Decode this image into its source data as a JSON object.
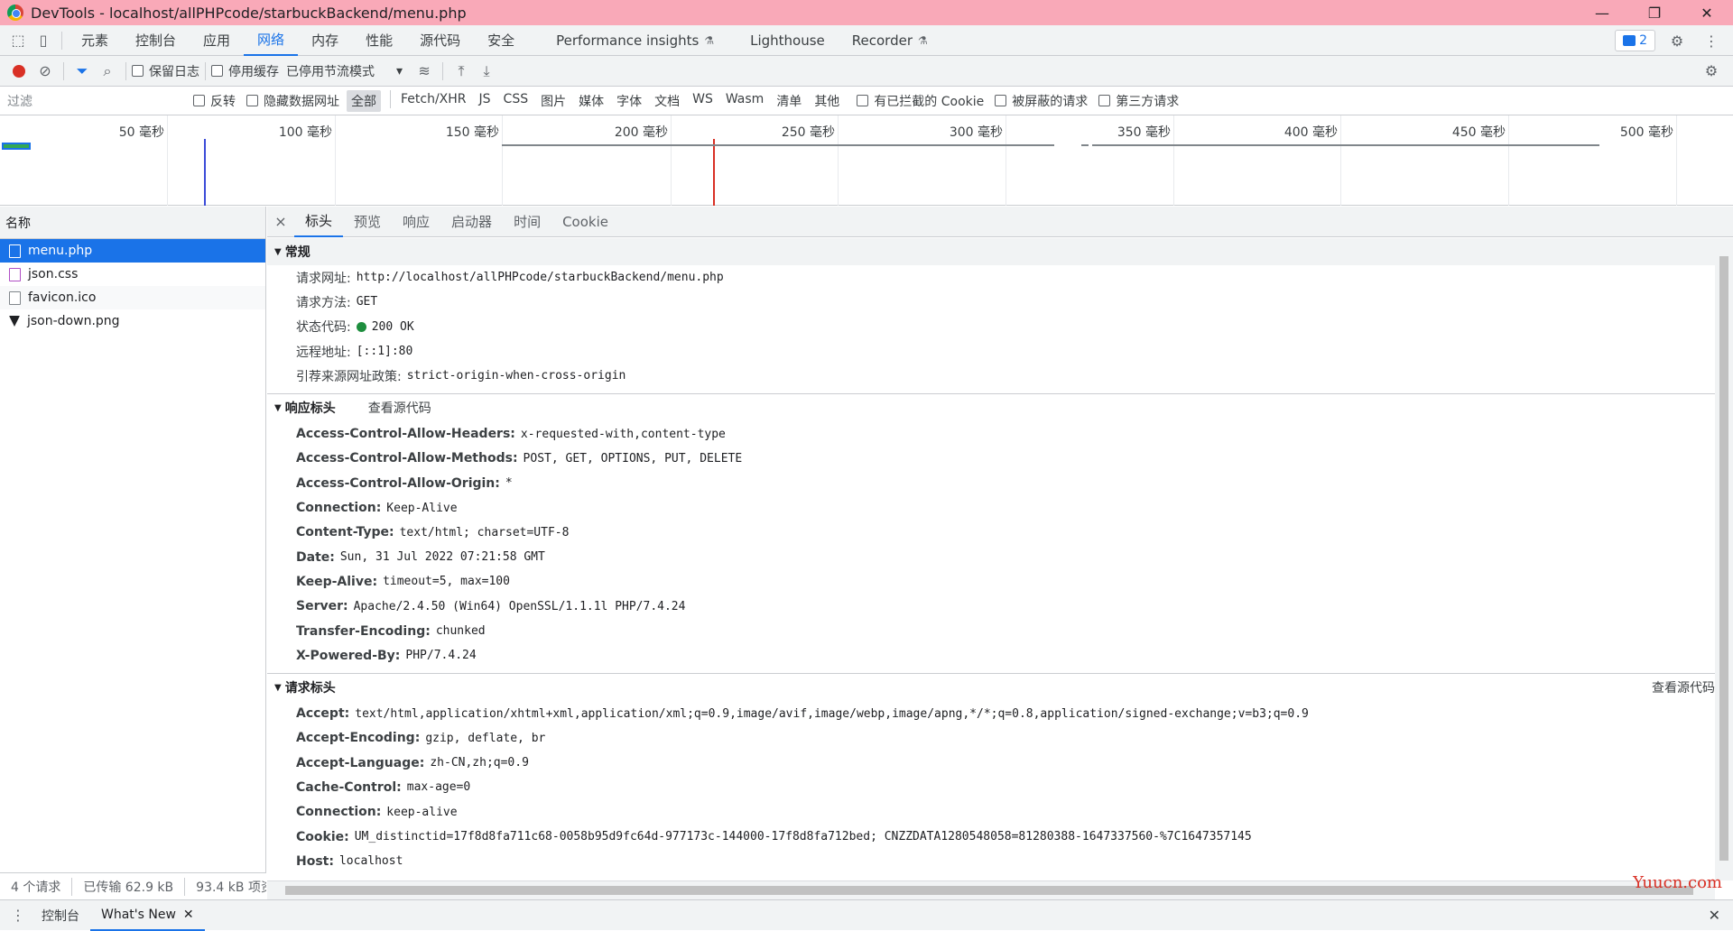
{
  "window": {
    "title": "DevTools - localhost/allPHPcode/starbuckBackend/menu.php",
    "controls": [
      "—",
      "❐",
      "✕"
    ]
  },
  "main_tabs": {
    "items": [
      "元素",
      "控制台",
      "应用",
      "网络",
      "内存",
      "性能",
      "源代码",
      "安全",
      "Performance insights",
      "Lighthouse",
      "Recorder"
    ],
    "active": "网络",
    "issues_count": "2"
  },
  "toolbar": {
    "preserve_log": "保留日志",
    "disable_cache": "停用缓存",
    "throttling": "已停用节流模式"
  },
  "filter": {
    "placeholder": "过滤",
    "invert": "反转",
    "hide_data_urls": "隐藏数据网址",
    "types": [
      "全部",
      "Fetch/XHR",
      "JS",
      "CSS",
      "图片",
      "媒体",
      "字体",
      "文档",
      "WS",
      "Wasm",
      "清单",
      "其他"
    ],
    "active_type": "全部",
    "blocked_cookies": "有已拦截的 Cookie",
    "blocked_requests": "被屏蔽的请求",
    "third_party": "第三方请求"
  },
  "timeline": {
    "labels": [
      "50 毫秒",
      "100 毫秒",
      "150 毫秒",
      "200 毫秒",
      "250 毫秒",
      "300 毫秒",
      "350 毫秒",
      "400 毫秒",
      "450 毫秒",
      "500 毫秒"
    ]
  },
  "request_list": {
    "header": "名称",
    "files": [
      {
        "name": "menu.php",
        "type": "doc"
      },
      {
        "name": "json.css",
        "type": "css"
      },
      {
        "name": "favicon.ico",
        "type": "doc"
      },
      {
        "name": "json-down.png",
        "type": "img"
      }
    ],
    "status": {
      "requests": "4 个请求",
      "transferred": "已传输 62.9 kB",
      "resources": "93.4 kB 项资"
    }
  },
  "detail_tabs": {
    "close": "×",
    "items": [
      "标头",
      "预览",
      "响应",
      "启动器",
      "时间",
      "Cookie"
    ],
    "active": "标头"
  },
  "general": {
    "title": "常规",
    "rows": [
      {
        "k": "请求网址:",
        "v": "http://localhost/allPHPcode/starbuckBackend/menu.php"
      },
      {
        "k": "请求方法:",
        "v": "GET"
      },
      {
        "k": "状态代码:",
        "v": "200 OK"
      },
      {
        "k": "远程地址:",
        "v": "[::1]:80"
      },
      {
        "k": "引荐来源网址政策:",
        "v": "strict-origin-when-cross-origin"
      }
    ]
  },
  "response_headers": {
    "title": "响应标头",
    "view_source": "查看源代码",
    "rows": [
      {
        "k": "Access-Control-Allow-Headers:",
        "v": "x-requested-with,content-type"
      },
      {
        "k": "Access-Control-Allow-Methods:",
        "v": "POST, GET, OPTIONS, PUT, DELETE"
      },
      {
        "k": "Access-Control-Allow-Origin:",
        "v": "*"
      },
      {
        "k": "Connection:",
        "v": "Keep-Alive"
      },
      {
        "k": "Content-Type:",
        "v": "text/html; charset=UTF-8"
      },
      {
        "k": "Date:",
        "v": "Sun, 31 Jul 2022 07:21:58 GMT"
      },
      {
        "k": "Keep-Alive:",
        "v": "timeout=5, max=100"
      },
      {
        "k": "Server:",
        "v": "Apache/2.4.50 (Win64) OpenSSL/1.1.1l PHP/7.4.24"
      },
      {
        "k": "Transfer-Encoding:",
        "v": "chunked"
      },
      {
        "k": "X-Powered-By:",
        "v": "PHP/7.4.24"
      }
    ]
  },
  "request_headers": {
    "title": "请求标头",
    "view_source": "查看源代码",
    "rows": [
      {
        "k": "Accept:",
        "v": "text/html,application/xhtml+xml,application/xml;q=0.9,image/avif,image/webp,image/apng,*/*;q=0.8,application/signed-exchange;v=b3;q=0.9"
      },
      {
        "k": "Accept-Encoding:",
        "v": "gzip, deflate, br"
      },
      {
        "k": "Accept-Language:",
        "v": "zh-CN,zh;q=0.9"
      },
      {
        "k": "Cache-Control:",
        "v": "max-age=0"
      },
      {
        "k": "Connection:",
        "v": "keep-alive"
      },
      {
        "k": "Cookie:",
        "v": "UM_distinctid=17f8d8fa711c68-0058b95d9fc64d-977173c-144000-17f8d8fa712bed; CNZZDATA1280548058=81280388-1647337560-%7C1647357145"
      },
      {
        "k": "Host:",
        "v": "localhost"
      }
    ]
  },
  "drawer": {
    "tabs": [
      "控制台",
      "What's New"
    ],
    "active": "What's New",
    "close": "✕"
  },
  "watermark": "Yuucn.com",
  "colors": {
    "accent": "#1a73e8",
    "titlebar": "#f9a9b8",
    "status_ok": "#1e8e3e",
    "record": "#d93025"
  }
}
